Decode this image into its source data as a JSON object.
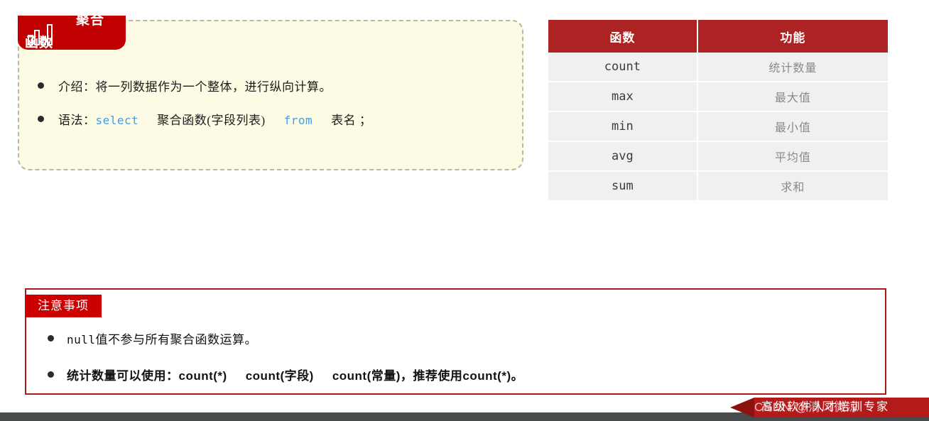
{
  "concept_card": {
    "badge": {
      "icon": "bar-chart-icon",
      "line1": "聚合",
      "line2": "函数"
    },
    "bullets": [
      {
        "prefix": "介绍：将一列数据作为一个整体，进行纵向计算。"
      },
      {
        "prefix": "语法：",
        "keyword1": "select",
        "middle": "聚合函数(字段列表)",
        "keyword2": "from",
        "suffix": "表名 ；"
      }
    ]
  },
  "function_table": {
    "headers": [
      "函数",
      "功能"
    ],
    "rows": [
      {
        "name": "count",
        "desc": "统计数量"
      },
      {
        "name": "max",
        "desc": "最大值"
      },
      {
        "name": "min",
        "desc": "最小值"
      },
      {
        "name": "avg",
        "desc": "平均值"
      },
      {
        "name": "sum",
        "desc": "求和"
      }
    ]
  },
  "notes": {
    "badge_label": "注意事项",
    "items": [
      {
        "mono": "null",
        "text": "值不参与所有聚合函数运算。"
      },
      {
        "text_a": "统计数量可以使用：count(*)",
        "text_b": "count(字段)",
        "text_c": "count(常量)，推荐使用count(*)。"
      }
    ]
  },
  "footer": {
    "banner_text": "高级软件人才培训专家",
    "watermark": "CSDN @清风微凉"
  },
  "colors": {
    "brand_red": "#c00000",
    "table_header_red": "#ad2222",
    "notes_border_red": "#a81b1b",
    "notes_badge_red": "#cc0000",
    "card_background": "#fdfbe4",
    "keyword_blue": "#3ea0e8",
    "footer_bar": "#474b4c"
  }
}
